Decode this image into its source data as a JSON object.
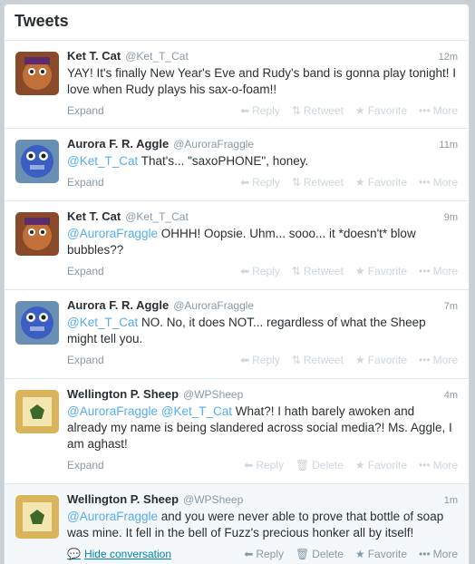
{
  "header": {
    "title": "Tweets"
  },
  "colors": {
    "link": "#55acee",
    "muted": "#8899a6",
    "faint": "#ccd6dd"
  },
  "tweets": [
    {
      "name": "Ket T. Cat",
      "handle": "@Ket_T_Cat",
      "time": "12m",
      "mention": "",
      "text": "YAY! It's finally New Year's Eve and Rudy's band is gonna play tonight! I love when Rudy plays his sax-o-foam!!",
      "expand": "Expand",
      "actions": [
        "Reply",
        "Retweet",
        "Favorite",
        "More"
      ]
    },
    {
      "name": "Aurora F. R. Aggle",
      "handle": "@AuroraFraggle",
      "time": "11m",
      "mention": "@Ket_T_Cat",
      "text": " That's... \"saxoPHONE\", honey.",
      "expand": "Expand",
      "actions": [
        "Reply",
        "Retweet",
        "Favorite",
        "More"
      ]
    },
    {
      "name": "Ket T. Cat",
      "handle": "@Ket_T_Cat",
      "time": "9m",
      "mention": "@AuroraFraggle",
      "text": " OHHH! Oopsie. Uhm... sooo... it *doesn't* blow bubbles??",
      "expand": "Expand",
      "actions": [
        "Reply",
        "Retweet",
        "Favorite",
        "More"
      ]
    },
    {
      "name": "Aurora F. R. Aggle",
      "handle": "@AuroraFraggle",
      "time": "7m",
      "mention": "@Ket_T_Cat",
      "text": " NO. No, it does NOT... regardless of what the Sheep might tell you.",
      "expand": "Expand",
      "actions": [
        "Reply",
        "Retweet",
        "Favorite",
        "More"
      ]
    },
    {
      "name": "Wellington P. Sheep",
      "handle": "@WPSheep",
      "time": "4m",
      "mention": "@AuroraFraggle @Ket_T_Cat",
      "text": " What?! I hath barely awoken and already my name is being slandered across social media?! Ms. Aggle, I am aghast!",
      "expand": "Expand",
      "actions": [
        "Reply",
        "Delete",
        "Favorite",
        "More"
      ]
    },
    {
      "name": "Wellington P. Sheep",
      "handle": "@WPSheep",
      "time": "1m",
      "mention": "@AuroraFraggle",
      "text": "  and you were never able to prove that bottle of soap was mine. It fell in the bell of Fuzz's precious honker all by itself!",
      "expand": "Hide conversation",
      "actions": [
        "Reply",
        "Delete",
        "Favorite",
        "More"
      ]
    }
  ]
}
